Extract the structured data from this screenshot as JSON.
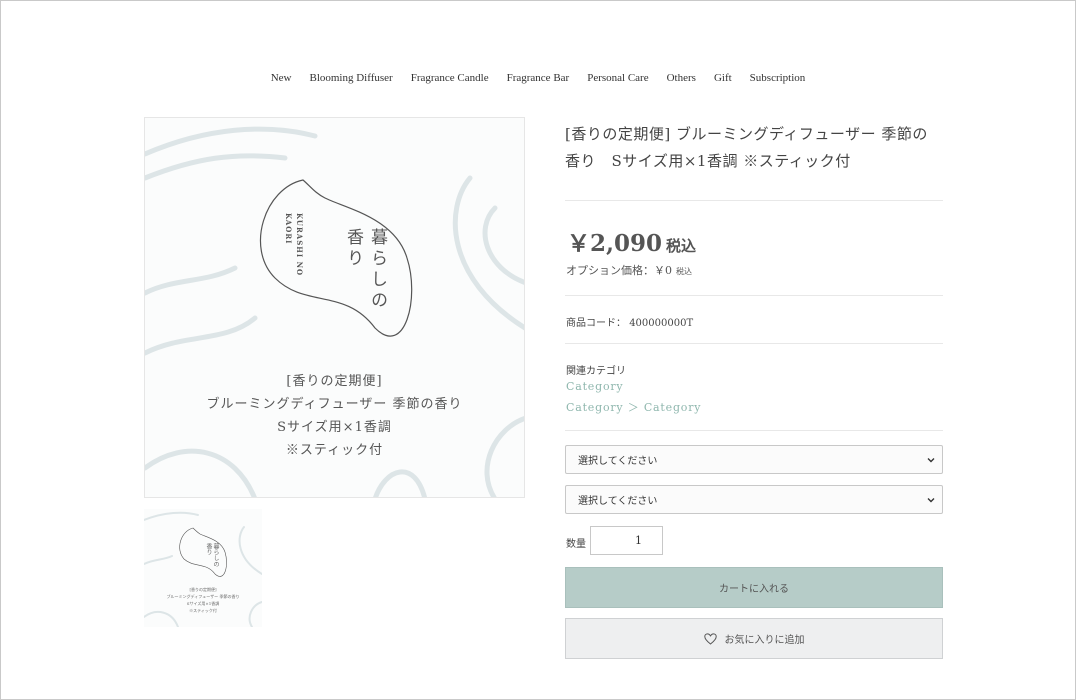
{
  "nav": {
    "items": [
      "New",
      "Blooming Diffuser",
      "Fragrance Candle",
      "Fragrance Bar",
      "Personal Care",
      "Others",
      "Gift",
      "Subscription"
    ]
  },
  "product_image": {
    "logo_main": "暮らしの",
    "logo_sub": "香り",
    "logo_en_1": "KURASHI NO",
    "logo_en_2": "KAORI",
    "lines": [
      "[香りの定期便]",
      "ブルーミングディフューザー 季節の香り",
      "Sサイズ用×1香調",
      "※スティック付"
    ]
  },
  "product": {
    "title": "[香りの定期便] ブルーミングディフューザー 季節の香り　Sサイズ用×1香調 ※スティック付",
    "price": "￥2,090",
    "price_tax": "税込",
    "option_price_label": "オプション価格：￥0",
    "option_price_tax": "税込",
    "code_label": "商品コード：",
    "code_value": "400000000T",
    "category_label": "関連カテゴリ",
    "category_1": "Category",
    "category_2": "Category ＞ Category"
  },
  "form": {
    "select_1": "選択してください",
    "select_2": "選択してください",
    "qty_label": "数量",
    "qty_value": "1",
    "cart_button": "カートに入れる",
    "fav_button": "お気に入りに追加"
  },
  "colors": {
    "accent": "#8fb7ae",
    "cart_button_bg": "#b6ccc8",
    "fav_button_bg": "#eeeff0"
  },
  "icons": {
    "select_chevron": "chevron-down-icon",
    "favorite": "heart-icon"
  }
}
